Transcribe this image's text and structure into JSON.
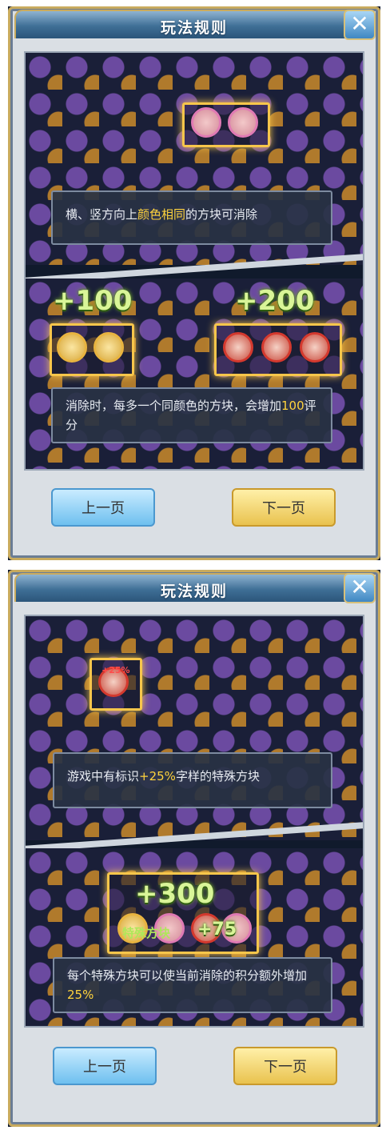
{
  "page1": {
    "title": "玩法规则",
    "close_symbol": "✕",
    "caption1": {
      "pre": "横、竖方向上",
      "highlight": "颜色相同",
      "post": "的方块可消除"
    },
    "score_a": "+100",
    "score_b": "+200",
    "caption2": {
      "pre": "消除时，每多一个同颜色的方块，会增加",
      "highlight": "100",
      "post": "评分"
    },
    "prev_label": "上一页",
    "next_label": "下一页"
  },
  "page2": {
    "title": "玩法规则",
    "close_symbol": "✕",
    "tag_label": "+25%",
    "caption1": {
      "pre": "游戏中有标识",
      "highlight": "+25%",
      "post": "字样的特殊方块"
    },
    "score": "+300",
    "special_label": "特殊方块",
    "special_bonus": "+75",
    "caption2": {
      "pre": "每个特殊方块可以使当前消除的积分额外增加",
      "highlight": "25%",
      "post": ""
    },
    "prev_label": "上一页",
    "next_label": "下一页"
  },
  "colors": {
    "gold": "#f7c64b",
    "highlight_text": "#ffd33d",
    "score_green": "#d9f598"
  }
}
